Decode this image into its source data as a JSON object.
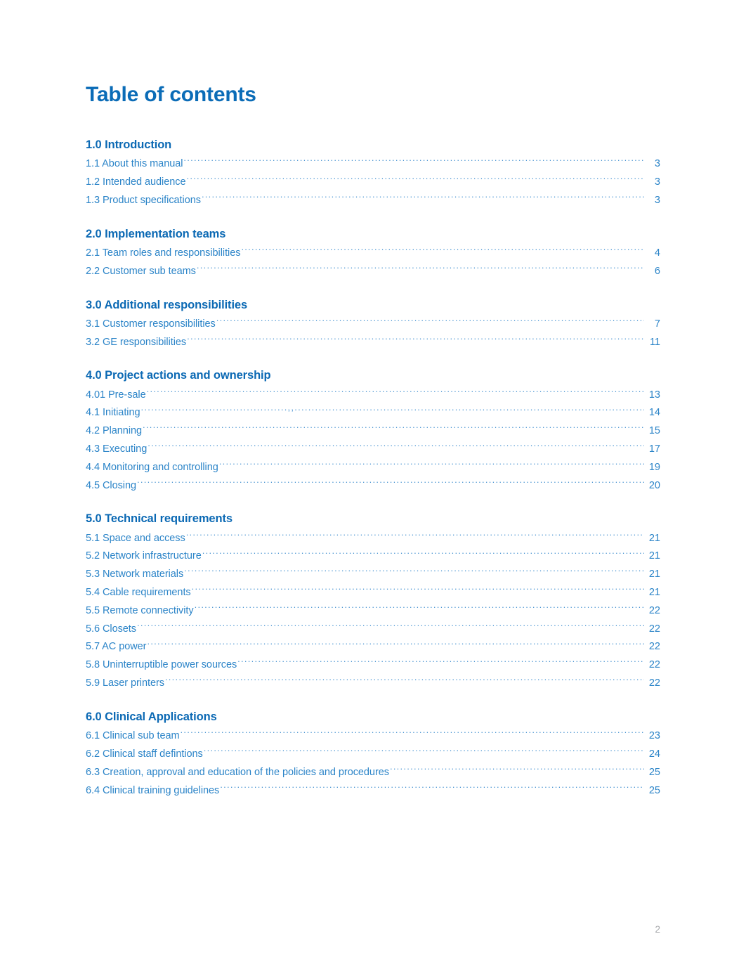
{
  "document": {
    "title": "Table of contents",
    "footer_page_number": "2",
    "colors": {
      "title_blue": "#0b6cb7",
      "heading_blue": "#0b69b4",
      "entry_blue": "#2b84c8",
      "leader_blue": "#4b95d2",
      "footer_gray": "#a6a8ab",
      "page_background": "#ffffff"
    }
  },
  "sections": [
    {
      "heading": "1.0 Introduction",
      "entries": [
        {
          "label": "1.1 About this manual",
          "page": "3",
          "leader": "plain"
        },
        {
          "label": "1.2 Intended audience",
          "page": "3",
          "leader": "plain"
        },
        {
          "label": "1.3 Product specifications",
          "page": "3",
          "leader": "plain"
        }
      ]
    },
    {
      "heading": "2.0 Implementation teams",
      "entries": [
        {
          "label": "2.1 Team roles and responsibilities",
          "page": "4",
          "leader": "plain"
        },
        {
          "label": "2.2 Customer sub teams",
          "page": "6",
          "leader": "comma-tail"
        }
      ]
    },
    {
      "heading": "3.0 Additional responsibilities",
      "entries": [
        {
          "label": "3.1 Customer responsibilities",
          "page": "7",
          "leader": "plain"
        },
        {
          "label": "3.2 GE responsibilities",
          "page": "11",
          "leader": "plain"
        }
      ]
    },
    {
      "heading": "4.0 Project actions and ownership",
      "entries": [
        {
          "label": "4.01 Pre-sale",
          "page": "13",
          "leader": "plain"
        },
        {
          "label": "4.1 Initiating",
          "page": "14",
          "leader": "comma-mid"
        },
        {
          "label": "4.2 Planning",
          "page": "15",
          "leader": "plain"
        },
        {
          "label": "4.3 Executing",
          "page": "17",
          "leader": "gap-before"
        },
        {
          "label": "4.4 Monitoring and controlling",
          "page": "19",
          "leader": "plain"
        },
        {
          "label": "4.5 Closing",
          "page": "20",
          "leader": "plain"
        }
      ]
    },
    {
      "heading": "5.0 Technical requirements",
      "entries": [
        {
          "label": "5.1 Space and access",
          "page": "21",
          "leader": "plain"
        },
        {
          "label": "5.2 Network infrastructure",
          "page": "21",
          "leader": "plain"
        },
        {
          "label": "5.3 Network materials",
          "page": "21",
          "leader": "plain"
        },
        {
          "label": "5.4 Cable requirements",
          "page": "21",
          "leader": "plain"
        },
        {
          "label": "5.5 Remote connectivity",
          "page": "22",
          "leader": "plain"
        },
        {
          "label": "5.6 Closets",
          "page": "22",
          "leader": "plain"
        },
        {
          "label": "5.7 AC power",
          "page": "22",
          "leader": "gap-before"
        },
        {
          "label": "5.8 Uninterruptible power sources",
          "page": "22",
          "leader": "plain"
        },
        {
          "label": "5.9 Laser printers",
          "page": "22",
          "leader": "plain"
        }
      ]
    },
    {
      "heading": "6.0 Clinical Applications",
      "entries": [
        {
          "label": "6.1 Clinical sub team",
          "page": "23",
          "leader": "plain"
        },
        {
          "label": "6.2 Clinical staff defintions",
          "page": "24",
          "leader": "plain"
        },
        {
          "label": "6.3 Creation, approval and education of the policies and procedures",
          "page": "25",
          "leader": "plain"
        },
        {
          "label": "6.4 Clinical training guidelines",
          "page": "25",
          "leader": "plain"
        }
      ]
    }
  ]
}
